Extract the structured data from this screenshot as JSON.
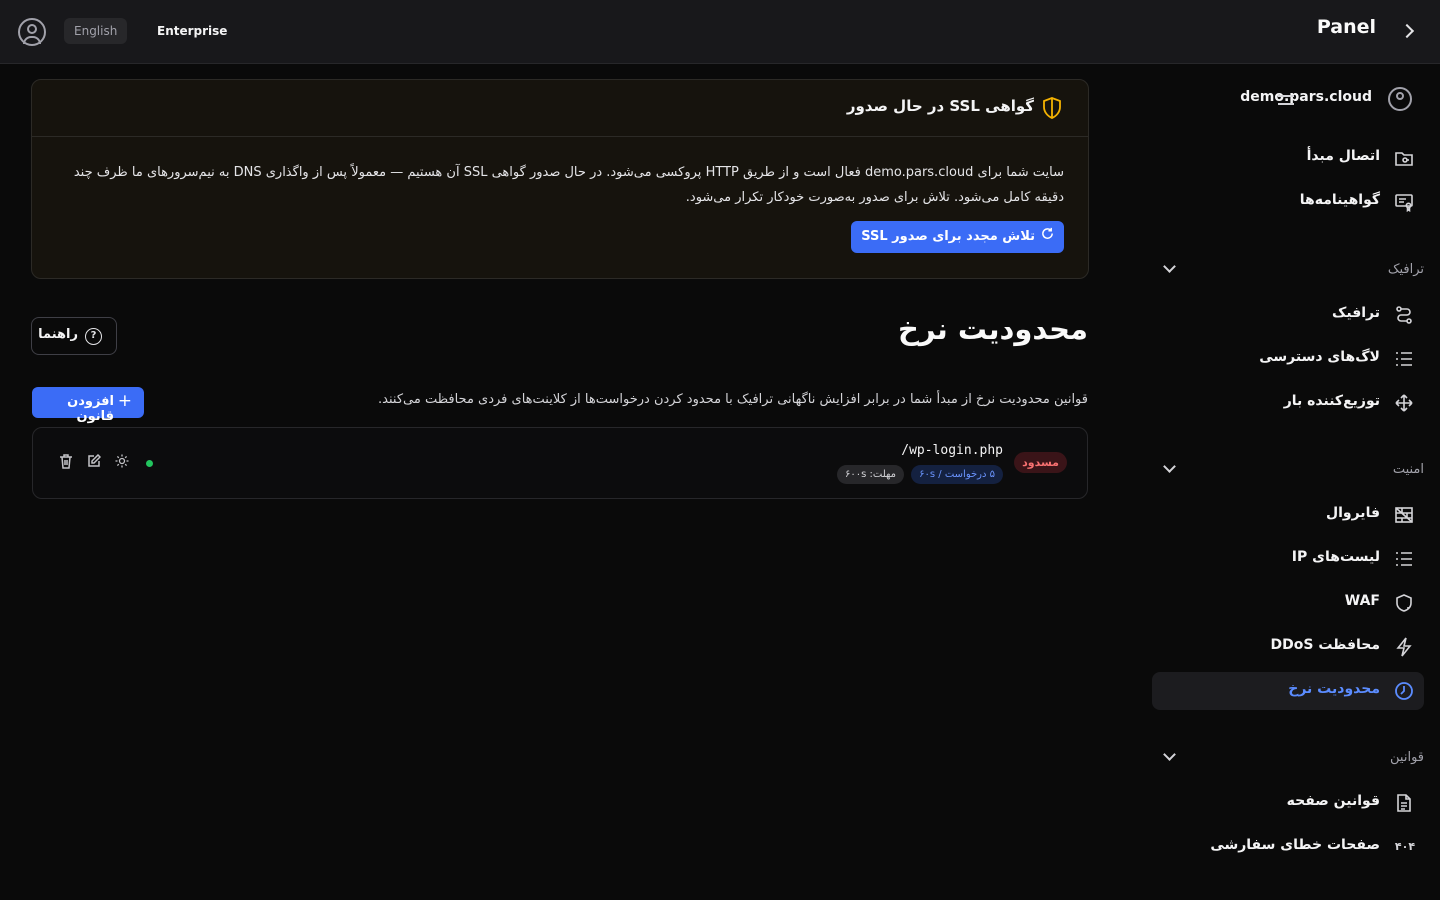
{
  "topbar": {
    "language": "English",
    "plan": "Enterprise",
    "title": "Panel"
  },
  "sidebar": {
    "domain": "demo.pars.cloud",
    "items_top": [
      {
        "label": "اتصال مبدأ",
        "icon": "folder-link-icon"
      },
      {
        "label": "گواهینامه‌ها",
        "icon": "certificate-icon"
      }
    ],
    "sections": [
      {
        "label": "ترافیک",
        "items": [
          {
            "label": "ترافیک",
            "icon": "route-icon"
          },
          {
            "label": "لاگ‌های دسترسی",
            "icon": "list-icon"
          },
          {
            "label": "توزیع‌کننده بار",
            "icon": "load-balancer-icon"
          }
        ]
      },
      {
        "label": "امنیت",
        "items": [
          {
            "label": "فایروال",
            "icon": "firewall-icon"
          },
          {
            "label": "لیست‌های IP",
            "icon": "list-icon"
          },
          {
            "label": "WAF",
            "icon": "shield-alert-icon"
          },
          {
            "label": "محافظت DDoS",
            "icon": "lightning-icon"
          },
          {
            "label": "محدودیت نرخ",
            "icon": "clock-icon",
            "active": true
          }
        ]
      },
      {
        "label": "قوانین",
        "items": [
          {
            "label": "قوانین صفحه",
            "icon": "document-icon"
          },
          {
            "label": "صفحات خطای سفارشی",
            "icon": "404-icon"
          }
        ]
      }
    ]
  },
  "ssl_banner": {
    "title": "گواهی SSL در حال صدور",
    "body": "سایت شما برای demo.pars.cloud فعال است و از طریق HTTP پروکسی می‌شود. در حال صدور گواهی SSL آن هستیم — معمولاً پس از واگذاری DNS به نیم‌سرورهای ما ظرف چند دقیقه کامل می‌شود. تلاش برای صدور به‌صورت خودکار تکرار می‌شود.",
    "retry_button": "تلاش مجدد برای صدور SSL"
  },
  "page": {
    "title": "محدودیت نرخ",
    "guide_button": "راهنما",
    "description": "قوانین محدودیت نرخ از مبدأ شما در برابر افزایش ناگهانی ترافیک با محدود کردن درخواست‌ها از کلاینت‌های فردی محافظت می‌کنند.",
    "add_button": "افزودن قانون"
  },
  "rules": [
    {
      "path": "/wp-login.php",
      "action": "مسدود",
      "rate": "۵ درخواست / ۶۰s",
      "timeout": "مهلت: ۶۰۰s",
      "enabled": true
    }
  ],
  "colors": {
    "accent": "#3b6cf6",
    "active_nav": "#5b8cff",
    "warning": "#f5b301",
    "blocked": "#f87171",
    "status_ok": "#22c55e"
  }
}
